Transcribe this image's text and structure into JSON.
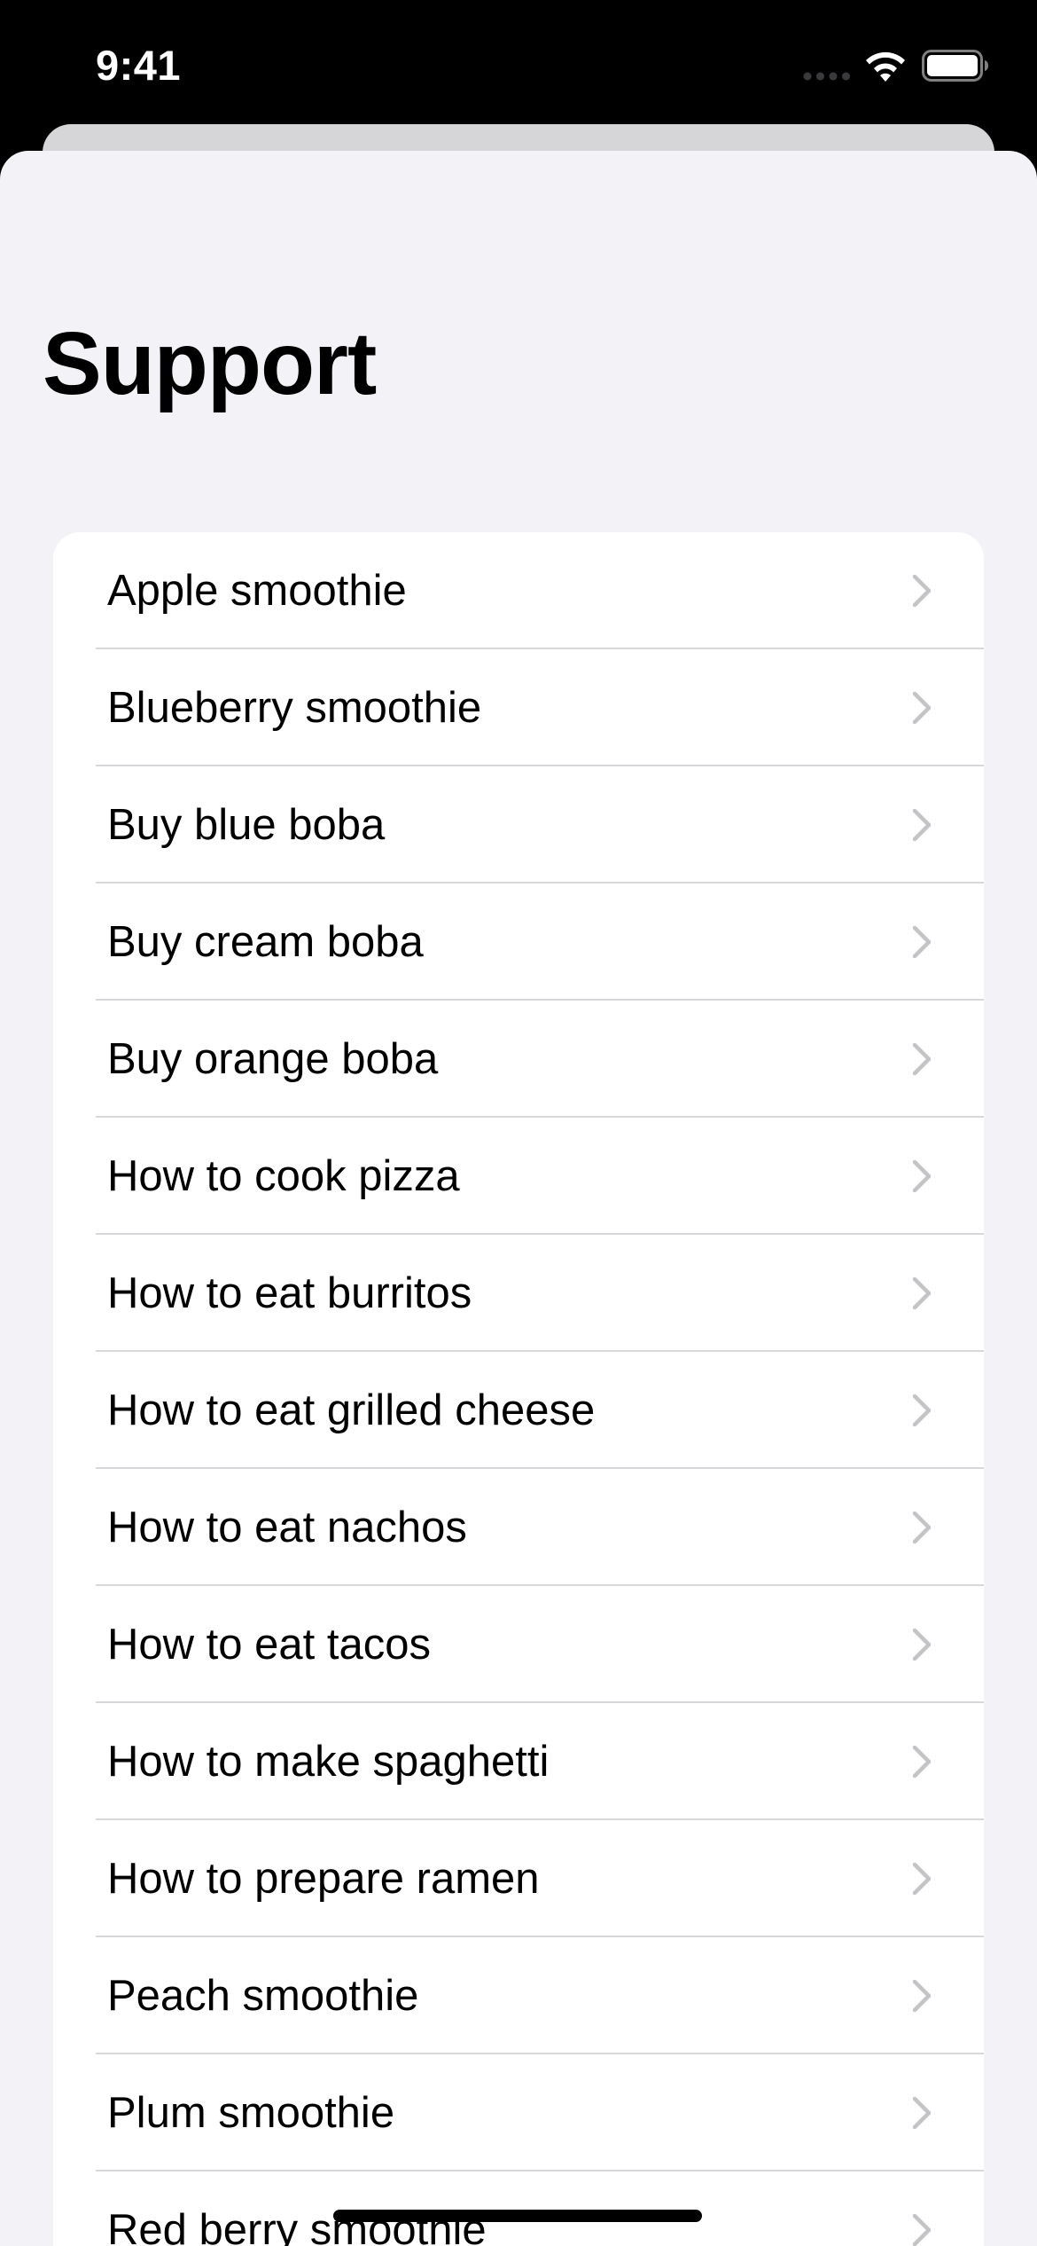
{
  "status_bar": {
    "time": "9:41",
    "icons": [
      "signal-icon",
      "wifi-icon",
      "battery-icon"
    ]
  },
  "page": {
    "title": "Support"
  },
  "list": {
    "items": [
      {
        "label": "Apple smoothie"
      },
      {
        "label": "Blueberry smoothie"
      },
      {
        "label": "Buy blue boba"
      },
      {
        "label": "Buy cream boba"
      },
      {
        "label": "Buy orange boba"
      },
      {
        "label": "How to cook pizza"
      },
      {
        "label": "How to eat burritos"
      },
      {
        "label": "How to eat grilled cheese"
      },
      {
        "label": "How to eat nachos"
      },
      {
        "label": "How to eat tacos"
      },
      {
        "label": "How to make spaghetti"
      },
      {
        "label": "How to prepare ramen"
      },
      {
        "label": "Peach smoothie"
      },
      {
        "label": "Plum smoothie"
      },
      {
        "label": "Red berry smoothie"
      }
    ],
    "row_icon": "chevron-right-icon"
  },
  "colors": {
    "background": "#f2f2f7",
    "card": "#ffffff",
    "divider": "#d8d8dc",
    "chevron": "#c4c4c7",
    "status_bar": "#000000"
  }
}
